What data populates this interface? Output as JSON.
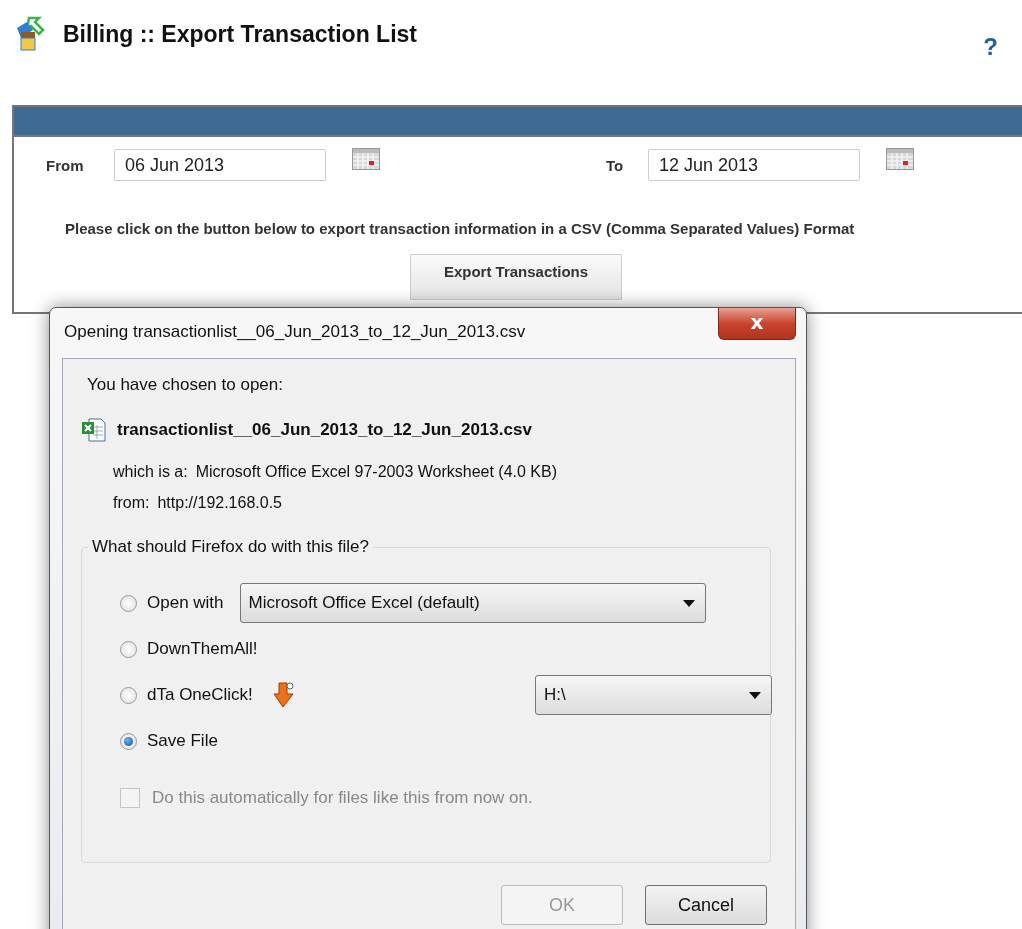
{
  "page": {
    "title": "Billing :: Export Transaction List",
    "help": "?"
  },
  "form": {
    "from_label": "From",
    "from_value": "06 Jun 2013",
    "to_label": "To",
    "to_value": "12 Jun 2013",
    "instruction": "Please click on the button below to export transaction information in a CSV (Comma Separated Values) Format",
    "export_button": "Export Transactions"
  },
  "dialog": {
    "title": "Opening transactionlist__06_Jun_2013_to_12_Jun_2013.csv",
    "close": "x",
    "intro": "You have chosen to open:",
    "file_name": "transactionlist__06_Jun_2013_to_12_Jun_2013.csv",
    "type_label": "which is a:",
    "type_value": "Microsoft Office Excel 97-2003 Worksheet (4.0 KB)",
    "from_label": "from:",
    "from_value": "http://192.168.0.5",
    "group_title": "What should Firefox do with this file?",
    "options": [
      {
        "kind": "select",
        "label": "Open with",
        "selected": false,
        "select_value": "Microsoft Office Excel (default)"
      },
      {
        "kind": "plain",
        "label": "DownThemAll!",
        "selected": false
      },
      {
        "kind": "icon_select",
        "label": "dTa OneClick!",
        "selected": false,
        "select_value": "H:\\"
      },
      {
        "kind": "plain",
        "label": "Save File",
        "selected": true
      }
    ],
    "auto": {
      "label": "Do this automatically for files like this from now on.",
      "checked": false,
      "disabled": true
    },
    "buttons": [
      {
        "label": "OK",
        "disabled": true
      },
      {
        "label": "Cancel",
        "disabled": false
      }
    ]
  }
}
